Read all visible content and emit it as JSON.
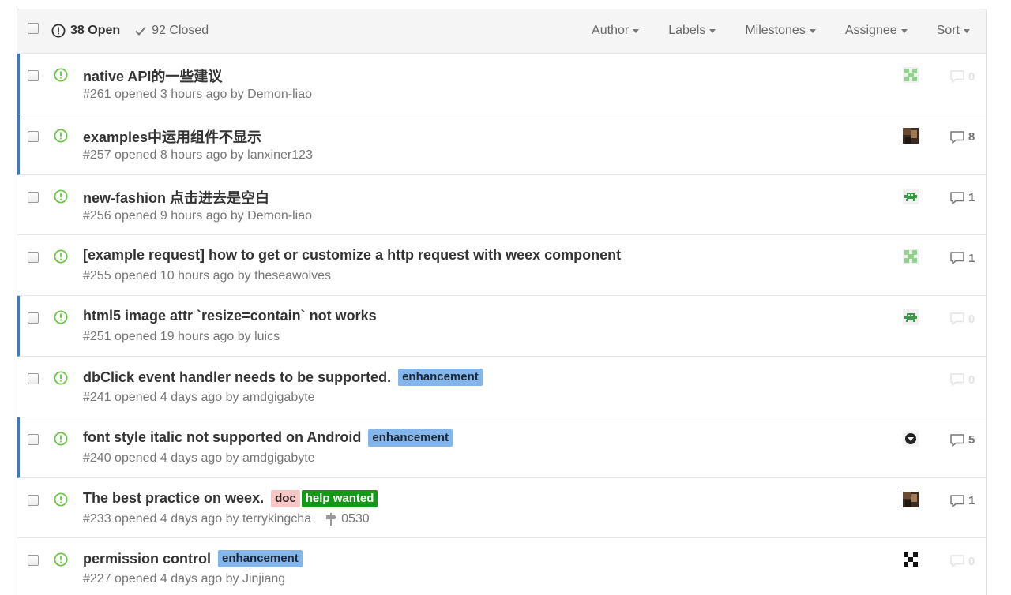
{
  "header": {
    "open_label": "38 Open",
    "closed_label": "92 Closed",
    "filters": [
      "Author",
      "Labels",
      "Milestones",
      "Assignee",
      "Sort"
    ]
  },
  "colors": {
    "unread_bar": "#4078c0",
    "open_icon": "#6cc644",
    "enhancement_bg": "#84b6eb",
    "enhancement_fg": "#1c2733",
    "doc_bg": "#f7c6c7",
    "doc_fg": "#332222",
    "help_wanted_bg": "#159818",
    "help_wanted_fg": "#ffffff"
  },
  "issues": [
    {
      "title": "native API的一些建议",
      "meta": "#261 opened 3 hours ago by Demon-liao",
      "labels": [],
      "comments": "0",
      "unread": true,
      "avatar": "green-pixel"
    },
    {
      "title": "examples中运用组件不显示",
      "meta": "#257 opened 8 hours ago by lanxiner123",
      "labels": [],
      "comments": "8",
      "unread": true,
      "avatar": "photo"
    },
    {
      "title": "new-fashion 点击进去是空白",
      "meta": "#256 opened 9 hours ago by Demon-liao",
      "labels": [],
      "comments": "1",
      "unread": false,
      "avatar": "invader"
    },
    {
      "title": "[example request] how to get or customize a http request with weex component",
      "meta": "#255 opened 10 hours ago by theseawolves",
      "labels": [],
      "comments": "1",
      "unread": false,
      "avatar": "green-pixel"
    },
    {
      "title": "html5 image attr `resize=contain` not works",
      "meta": "#251 opened 19 hours ago by luics",
      "labels": [],
      "comments": "0",
      "unread": true,
      "avatar": "invader"
    },
    {
      "title": "dbClick event handler needs to be supported.",
      "meta": "#241 opened 4 days ago by amdgigabyte",
      "labels": [
        "enhancement"
      ],
      "comments": "0",
      "unread": false,
      "avatar": ""
    },
    {
      "title": "font style italic not supported on Android",
      "meta": "#240 opened 4 days ago by amdgigabyte",
      "labels": [
        "enhancement"
      ],
      "comments": "5",
      "unread": true,
      "avatar": "logo"
    },
    {
      "title": "The best practice on weex.",
      "meta": "#233 opened 4 days ago by terrykingcha",
      "labels": [
        "doc",
        "help wanted"
      ],
      "milestone": "0530",
      "comments": "1",
      "unread": false,
      "avatar": "photo"
    },
    {
      "title": "permission control",
      "meta": "#227 opened 4 days ago by Jinjiang",
      "labels": [
        "enhancement"
      ],
      "comments": "0",
      "unread": false,
      "avatar": "black-pixel"
    }
  ]
}
